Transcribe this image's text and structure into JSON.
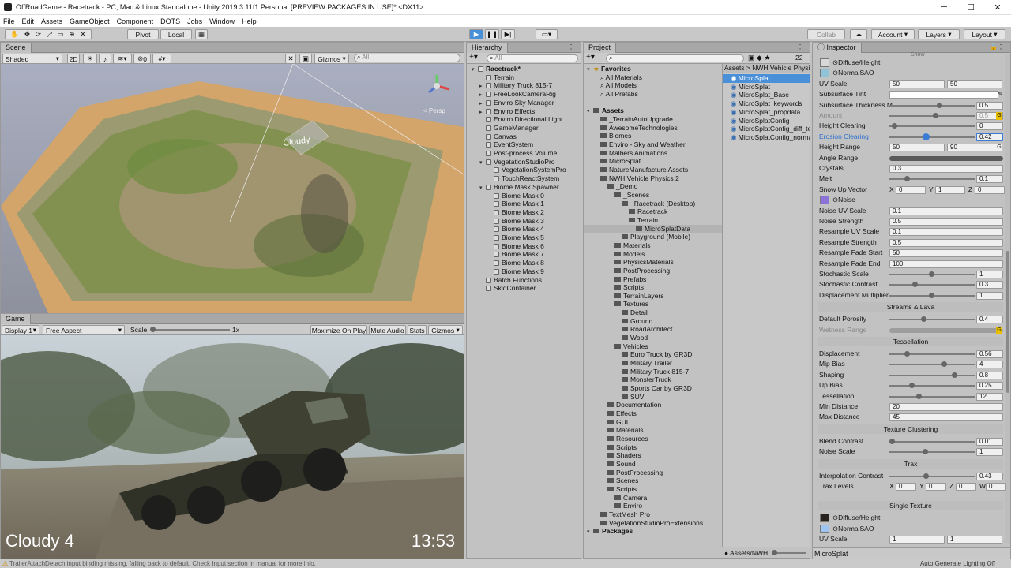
{
  "window": {
    "title": "OffRoadGame - Racetrack - PC, Mac & Linux Standalone - Unity 2019.3.11f1 Personal [PREVIEW PACKAGES IN USE]* <DX11>",
    "min": "─",
    "max": "☐",
    "close": "✕"
  },
  "menu": [
    "File",
    "Edit",
    "Assets",
    "GameObject",
    "Component",
    "DOTS",
    "Jobs",
    "Window",
    "Help"
  ],
  "toolbar": {
    "pivot": "Pivot",
    "local": "Local",
    "collab": "Collab",
    "account": "Account",
    "layers": "Layers",
    "layout": "Layout"
  },
  "scene": {
    "tab": "Scene",
    "shading": "Shaded",
    "mode2d": "2D",
    "gizmos": "Gizmos",
    "search_placeholder": "All",
    "persp": "< Persp",
    "cloud_label": "Cloudy",
    "fx_count": "0"
  },
  "game": {
    "tab": "Game",
    "display": "Display 1",
    "aspect": "Free Aspect",
    "scale_label": "Scale",
    "scale_value": "1x",
    "maximize": "Maximize On Play",
    "mute": "Mute Audio",
    "stats": "Stats",
    "gizmos": "Gizmos",
    "overlay_weather": "Cloudy 4",
    "overlay_time": "13:53"
  },
  "hierarchy": {
    "tab": "Hierarchy",
    "search_placeholder": "All",
    "items": [
      {
        "label": "Racetrack*",
        "d": 0,
        "bold": true
      },
      {
        "label": "Terrain",
        "d": 1
      },
      {
        "label": "Military Truck 815-7",
        "d": 1
      },
      {
        "label": "FreeLookCameraRig",
        "d": 1
      },
      {
        "label": "Enviro Sky Manager",
        "d": 1
      },
      {
        "label": "Enviro Effects",
        "d": 1
      },
      {
        "label": "Enviro Directional Light",
        "d": 1
      },
      {
        "label": "GameManager",
        "d": 1
      },
      {
        "label": "Canvas",
        "d": 1
      },
      {
        "label": "EventSystem",
        "d": 1
      },
      {
        "label": "Post-process Volume",
        "d": 1
      },
      {
        "label": "VegetationStudioPro",
        "d": 1
      },
      {
        "label": "VegetationSystemPro",
        "d": 2
      },
      {
        "label": "TouchReactSystem",
        "d": 2
      },
      {
        "label": "Biome Mask Spawner",
        "d": 1
      },
      {
        "label": "Biome Mask 0",
        "d": 2
      },
      {
        "label": "Biome Mask 1",
        "d": 2
      },
      {
        "label": "Biome Mask 2",
        "d": 2
      },
      {
        "label": "Biome Mask 3",
        "d": 2
      },
      {
        "label": "Biome Mask 4",
        "d": 2
      },
      {
        "label": "Biome Mask 5",
        "d": 2
      },
      {
        "label": "Biome Mask 6",
        "d": 2
      },
      {
        "label": "Biome Mask 7",
        "d": 2
      },
      {
        "label": "Biome Mask 8",
        "d": 2
      },
      {
        "label": "Biome Mask 9",
        "d": 2
      },
      {
        "label": "Batch Functions",
        "d": 1
      },
      {
        "label": "SkidContainer",
        "d": 1
      }
    ]
  },
  "project": {
    "tab": "Project",
    "count": "22",
    "breadcrumb": "Assets > NWH Vehicle Physi",
    "bottom_path": "Assets/NWH",
    "tree": [
      {
        "label": "Favorites",
        "d": 0,
        "bold": true
      },
      {
        "label": "All Materials",
        "d": 1
      },
      {
        "label": "All Models",
        "d": 1
      },
      {
        "label": "All Prefabs",
        "d": 1
      },
      {
        "label": "",
        "d": 0
      },
      {
        "label": "Assets",
        "d": 0,
        "bold": true
      },
      {
        "label": "_TerrainAutoUpgrade",
        "d": 1
      },
      {
        "label": "AwesomeTechnologies",
        "d": 1
      },
      {
        "label": "Biomes",
        "d": 1
      },
      {
        "label": "Enviro - Sky and Weather",
        "d": 1
      },
      {
        "label": "Malbers Animations",
        "d": 1
      },
      {
        "label": "MicroSplat",
        "d": 1
      },
      {
        "label": "NatureManufacture Assets",
        "d": 1
      },
      {
        "label": "NWH Vehicle Physics 2",
        "d": 1
      },
      {
        "label": "_Demo",
        "d": 2
      },
      {
        "label": "_Scenes",
        "d": 3
      },
      {
        "label": "_Racetrack (Desktop)",
        "d": 4
      },
      {
        "label": "Racetrack",
        "d": 5
      },
      {
        "label": "Terrain",
        "d": 5
      },
      {
        "label": "MicroSplatData",
        "d": 6,
        "sel": true
      },
      {
        "label": "Playground (Mobile)",
        "d": 4
      },
      {
        "label": "Materials",
        "d": 3
      },
      {
        "label": "Models",
        "d": 3
      },
      {
        "label": "PhysicsMaterials",
        "d": 3
      },
      {
        "label": "PostProcessing",
        "d": 3
      },
      {
        "label": "Prefabs",
        "d": 3
      },
      {
        "label": "Scripts",
        "d": 3
      },
      {
        "label": "TerrainLayers",
        "d": 3
      },
      {
        "label": "Textures",
        "d": 3
      },
      {
        "label": "Detail",
        "d": 4
      },
      {
        "label": "Ground",
        "d": 4
      },
      {
        "label": "RoadArchitect",
        "d": 4
      },
      {
        "label": "Wood",
        "d": 4
      },
      {
        "label": "Vehicles",
        "d": 3
      },
      {
        "label": "Euro Truck by GR3D",
        "d": 4
      },
      {
        "label": "Military Trailer",
        "d": 4
      },
      {
        "label": "Military Truck 815-7",
        "d": 4
      },
      {
        "label": "MonsterTruck",
        "d": 4
      },
      {
        "label": "Sports Car by GR3D",
        "d": 4
      },
      {
        "label": "SUV",
        "d": 4
      },
      {
        "label": "Documentation",
        "d": 2
      },
      {
        "label": "Effects",
        "d": 2
      },
      {
        "label": "GUI",
        "d": 2
      },
      {
        "label": "Materials",
        "d": 2
      },
      {
        "label": "Resources",
        "d": 2
      },
      {
        "label": "Scripts",
        "d": 2
      },
      {
        "label": "Shaders",
        "d": 2
      },
      {
        "label": "Sound",
        "d": 2
      },
      {
        "label": "PostProcessing",
        "d": 2
      },
      {
        "label": "Scenes",
        "d": 2
      },
      {
        "label": "Scripts",
        "d": 2
      },
      {
        "label": "Camera",
        "d": 3
      },
      {
        "label": "Enviro",
        "d": 3
      },
      {
        "label": "TextMesh Pro",
        "d": 1
      },
      {
        "label": "VegetationStudioProExtensions",
        "d": 1
      },
      {
        "label": "Packages",
        "d": 0,
        "bold": true
      }
    ],
    "files": [
      "MicroSplat",
      "MicroSplat",
      "MicroSplat_Base",
      "MicroSplat_keywords",
      "MicroSplat_propdata",
      "MicroSplatConfig",
      "MicroSplatConfig_diff_tex",
      "MicroSplatConfig_normal"
    ]
  },
  "inspector": {
    "tab": "Inspector",
    "footer": "MicroSplat",
    "top_label": "Show",
    "rows": [
      {
        "t": "tex",
        "label": "Diffuse/Height",
        "color": "#d8d8d8"
      },
      {
        "t": "tex",
        "label": "NormalSAO",
        "color": "#8fc3d6"
      },
      {
        "t": "v2",
        "label": "UV Scale",
        "a": "50",
        "b": "50"
      },
      {
        "t": "col",
        "label": "Subsurface Tint"
      },
      {
        "t": "sl",
        "label": "Subsurface Thickness M",
        "pos": 0.6,
        "val": "0.5"
      },
      {
        "t": "sl",
        "label": "Amount",
        "pos": 0.55,
        "val": "0.5",
        "dis": true,
        "g": true
      },
      {
        "t": "sl",
        "label": "Height Clearing",
        "pos": 0.05,
        "val": "0"
      },
      {
        "t": "sl",
        "label": "Erosion Clearing",
        "pos": 0.42,
        "val": "0.42",
        "hl": true
      },
      {
        "t": "v2",
        "label": "Height Range",
        "a": "50",
        "b": "90",
        "g2": true
      },
      {
        "t": "bar",
        "label": "Angle Range"
      },
      {
        "t": "f",
        "label": "Crystals",
        "a": "0.3"
      },
      {
        "t": "sl",
        "label": "Melt",
        "pos": 0.2,
        "val": "0.1"
      },
      {
        "t": "v3",
        "label": "Snow Up Vector",
        "x": "0",
        "y": "1",
        "z": "0"
      },
      {
        "t": "tex",
        "label": "Noise",
        "color": "#8a74d8"
      },
      {
        "t": "f",
        "label": "Noise UV Scale",
        "a": "0.1"
      },
      {
        "t": "f",
        "label": "Noise Strength",
        "a": "0.5"
      },
      {
        "t": "f",
        "label": "Resample UV Scale",
        "a": "0.1"
      },
      {
        "t": "f",
        "label": "Resample Strength",
        "a": "0.5"
      },
      {
        "t": "f",
        "label": "Resample Fade Start",
        "a": "50"
      },
      {
        "t": "f",
        "label": "Resample Fade End",
        "a": "100"
      },
      {
        "t": "sl",
        "label": "Stochastic Scale",
        "pos": 0.5,
        "val": "1"
      },
      {
        "t": "sl",
        "label": "Stochastic Contrast",
        "pos": 0.3,
        "val": "0.3"
      },
      {
        "t": "sl",
        "label": "Displacement Multiplier",
        "pos": 0.5,
        "val": "1"
      },
      {
        "t": "h",
        "label": "Streams & Lava"
      },
      {
        "t": "sl",
        "label": "Default Porosity",
        "pos": 0.4,
        "val": "0.4"
      },
      {
        "t": "bar",
        "label": "Wetness Range",
        "dis": true,
        "g": true
      },
      {
        "t": "h",
        "label": "Tessellation"
      },
      {
        "t": "sl",
        "label": "Displacement",
        "pos": 0.2,
        "val": "0.56"
      },
      {
        "t": "sl",
        "label": "Mip Bias",
        "pos": 0.65,
        "val": "4"
      },
      {
        "t": "sl",
        "label": "Shaping",
        "pos": 0.78,
        "val": "0.8"
      },
      {
        "t": "sl",
        "label": "Up Bias",
        "pos": 0.26,
        "val": "0.25"
      },
      {
        "t": "sl",
        "label": "Tessellation",
        "pos": 0.35,
        "val": "12"
      },
      {
        "t": "f",
        "label": "Min Distance",
        "a": "20"
      },
      {
        "t": "f",
        "label": "Max Distance",
        "a": "45"
      },
      {
        "t": "h",
        "label": "Texture Clustering"
      },
      {
        "t": "sl",
        "label": "Blend Contrast",
        "pos": 0.02,
        "val": "0.01"
      },
      {
        "t": "sl",
        "label": "Noise Scale",
        "pos": 0.42,
        "val": "1"
      },
      {
        "t": "h",
        "label": "Trax"
      },
      {
        "t": "sl",
        "label": "Interpolation Contrast",
        "pos": 0.43,
        "val": "0.43"
      },
      {
        "t": "v4",
        "label": "Trax Levels",
        "x": "0",
        "y": "0",
        "z": "0",
        "w": "0"
      },
      {
        "t": "gap",
        "label": ""
      },
      {
        "t": "h",
        "label": "Single Texture"
      },
      {
        "t": "tex",
        "label": "Diffuse/Height",
        "color": "#2a2420"
      },
      {
        "t": "tex",
        "label": "NormalSAO",
        "color": "#9ec4ef"
      },
      {
        "t": "v2",
        "label": "UV Scale",
        "a": "1",
        "b": "1"
      }
    ]
  },
  "status": {
    "message": "TrailerAttachDetach input binding missing, falling back to default. Check Input section in manual for more info.",
    "right": "Auto Generate Lighting Off"
  }
}
